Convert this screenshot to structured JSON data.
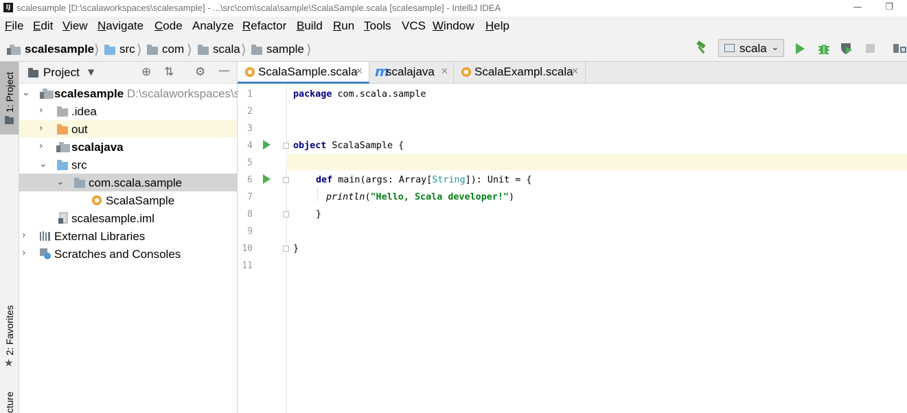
{
  "window": {
    "title": "scalesample [D:\\scalaworkspaces\\scalesample] - ...\\src\\com\\scala\\sample\\ScalaSample.scala [scalesample] - IntelliJ IDEA",
    "app_icon": "IJ"
  },
  "menu": [
    {
      "mnemonic": "F",
      "rest": "ile"
    },
    {
      "mnemonic": "E",
      "rest": "dit"
    },
    {
      "mnemonic": "V",
      "rest": "iew"
    },
    {
      "mnemonic": "N",
      "rest": "avigate"
    },
    {
      "mnemonic": "C",
      "rest": "ode"
    },
    {
      "mnemonic": "",
      "rest": "Analyze"
    },
    {
      "mnemonic": "R",
      "rest": "efactor"
    },
    {
      "mnemonic": "B",
      "rest": "uild"
    },
    {
      "mnemonic": "R",
      "rest": "un"
    },
    {
      "mnemonic": "T",
      "rest": "ools"
    },
    {
      "mnemonic": "",
      "rest": "VCS"
    },
    {
      "mnemonic": "W",
      "rest": "indow"
    },
    {
      "mnemonic": "H",
      "rest": "elp"
    }
  ],
  "breadcrumbs": [
    "scalesample",
    "src",
    "com",
    "scala",
    "sample"
  ],
  "toolbar": {
    "run_config": "scala",
    "icons": [
      "build-hammer-icon",
      "run-icon",
      "debug-icon",
      "coverage-icon",
      "stop-icon",
      "project-structure-icon"
    ]
  },
  "left_strip": {
    "project": "1: Project",
    "favorites": "2: Favorites",
    "structure": "cture"
  },
  "project_panel": {
    "title": "Project",
    "tree": [
      {
        "label": "scalesample",
        "path": "D:\\scalaworkspaces\\s",
        "expanded": true
      },
      {
        "label": ".idea",
        "expanded": false
      },
      {
        "label": "out",
        "expanded": false
      },
      {
        "label": "scalajava",
        "expanded": false
      },
      {
        "label": "src",
        "expanded": true
      },
      {
        "label": "com.scala.sample",
        "expanded": true
      },
      {
        "label": "ScalaSample"
      },
      {
        "label": "scalesample.iml"
      },
      {
        "label": "External Libraries",
        "expanded": false
      },
      {
        "label": "Scratches and Consoles",
        "expanded": false
      }
    ]
  },
  "tabs": [
    {
      "label": "ScalaSample.scala",
      "active": true
    },
    {
      "label": "scalajava",
      "active": false
    },
    {
      "label": "ScalaExampl.scala",
      "active": false
    }
  ],
  "editor": {
    "line_numbers": [
      "1",
      "2",
      "3",
      "4",
      "5",
      "6",
      "7",
      "8",
      "9",
      "10",
      "11"
    ],
    "current_line": 5,
    "code": {
      "l1_kw": "package",
      "l1_rest": " com.scala.sample",
      "l4_kw": "object",
      "l4_rest": " ScalaSample {",
      "l6_kw": "def",
      "l6_a": " main(args: Array[",
      "l6_type": "String",
      "l6_b": "]): Unit = {",
      "l7_fn": "println",
      "l7_open": "(",
      "l7_str": "\"Hello, Scala developer!\"",
      "l7_close": ")",
      "l8": "}",
      "l10": "}"
    }
  },
  "colors": {
    "keyword": "#000080",
    "string": "#067d17",
    "type": "#20999d",
    "current_line": "#fcf8e0",
    "selection": "#d4d4d4",
    "tab_underline": "#4083c9",
    "run_green": "#4caf50"
  }
}
